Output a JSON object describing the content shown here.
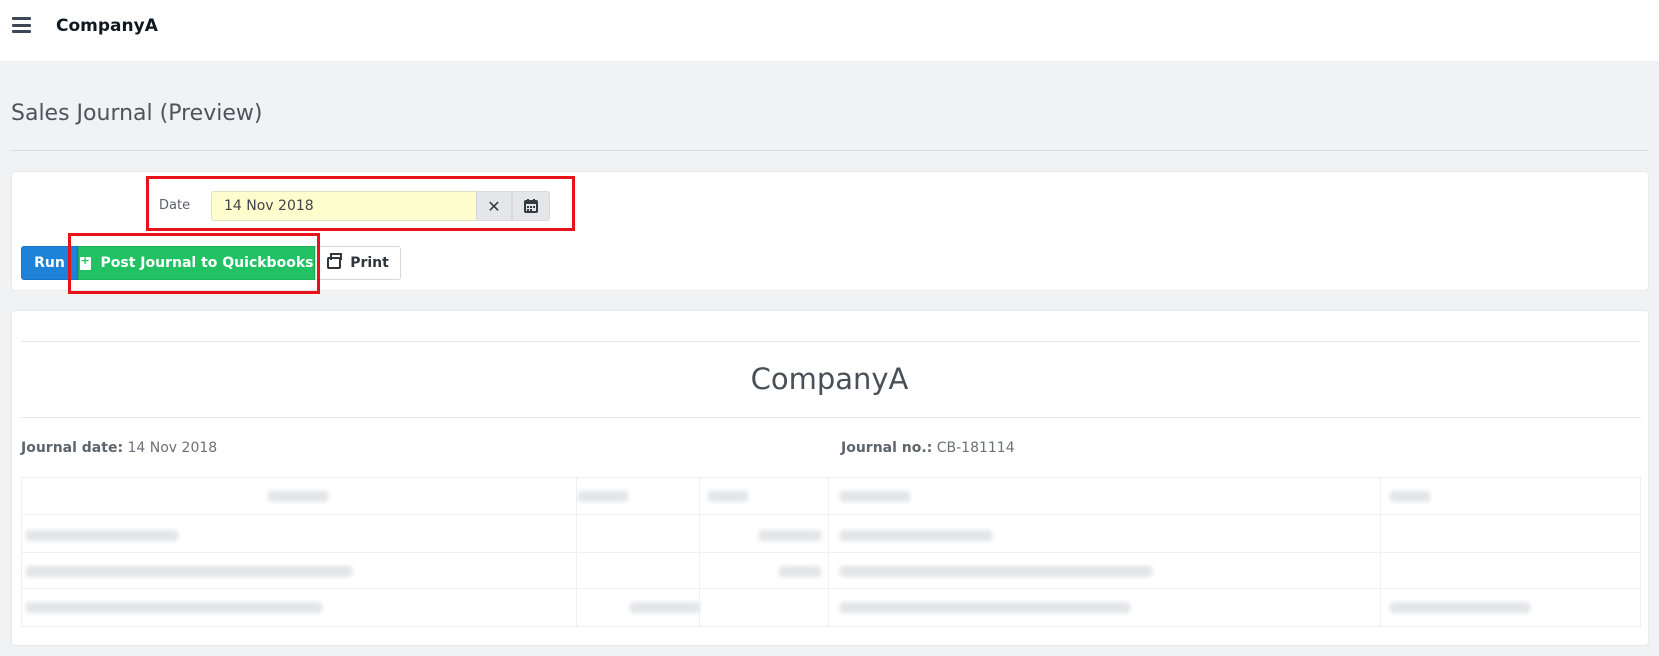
{
  "header": {
    "menu_icon": "hamburger-menu-icon",
    "brand": "CompanyA"
  },
  "page": {
    "title": "Sales Journal (Preview)"
  },
  "filter": {
    "date_label": "Date",
    "date_value": "14 Nov 2018",
    "clear_icon": "close-icon",
    "calendar_icon": "calendar-icon"
  },
  "actions": {
    "run_label": "Run",
    "post_label": "Post Journal to Quickbooks",
    "post_icon": "file-plus-icon",
    "print_label": "Print",
    "print_icon": "printer-icon"
  },
  "report": {
    "company": "CompanyA",
    "journal_date_label": "Journal date:",
    "journal_date_value": "14 Nov 2018",
    "journal_no_label": "Journal no.:",
    "journal_no_value": "CB-181114"
  },
  "highlight_color": "#e8121b"
}
